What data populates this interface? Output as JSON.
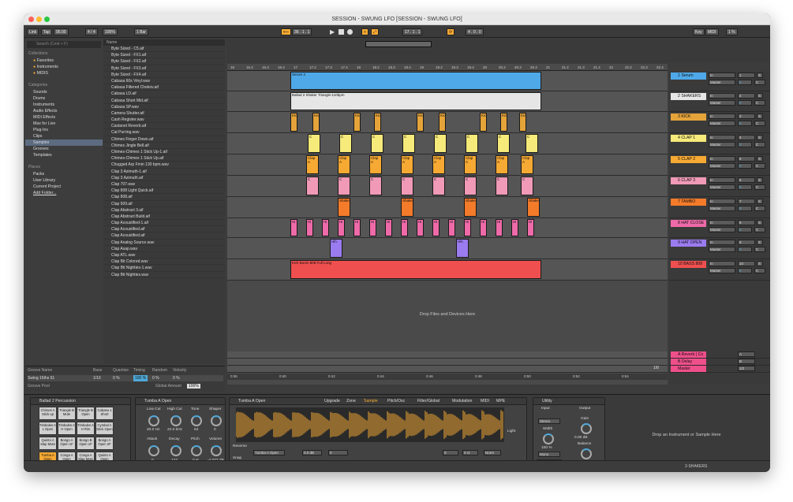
{
  "window": {
    "title": "SESSION - SWUNG LFO  [SESSION - SWUNG LFO]"
  },
  "control": {
    "link": "Link",
    "tap": "Tap",
    "tempo": "95.00",
    "sig": "4 / 4",
    "zoom": "100%",
    "bar": "1 Bar",
    "pos1": "36 .  1 .  1",
    "pos2": "17 .  1 .  1",
    "len": "4 .  0 .  0",
    "key": "Key",
    "midi": "MIDI",
    "cpu": "1 %"
  },
  "browser": {
    "search_placeholder": "Search (Cmd + F)",
    "collections_h": "Collections",
    "collections": [
      "Favorites",
      "Instruments",
      "MIDIS"
    ],
    "categories_h": "Categories",
    "categories": [
      "Sounds",
      "Drums",
      "Instruments",
      "Audio Effects",
      "MIDI Effects",
      "Max for Live",
      "Plug-Ins",
      "Clips",
      "Samples",
      "Grooves",
      "Templates"
    ],
    "places_h": "Places",
    "places": [
      "Packs",
      "User Library",
      "Current Project",
      "Add Folder..."
    ],
    "name_h": "Name",
    "files": [
      "Byte Sized - C5.aif",
      "Byte Sized - FX1.aif",
      "Byte Sized - FX2.aif",
      "Byte Sized - FX3.aif",
      "Byte Sized - FX4.aif",
      "Cabasa 60s Vinyl.wav",
      "Cabasa Filtered Chekov.aif",
      "Cabasa LD.aif",
      "Cabasa Short Mid.aif",
      "Cabasa SP.wav",
      "Camera Shutter.aif",
      "Cash Register.wav",
      "Castanet Reverb.aif",
      "Cat Purring.wav",
      "Chimes Finger Down.aif",
      "Chimes Jingle Bell.aif",
      "Chimes-Chimes 1 Stick Up-1.aif",
      "Chimes-Chimes 1 Stick Up.aif",
      "Chugged Arp Fmin 130 bpm.wav",
      "Clap 3 Azimuth-1.aif",
      "Clap 3 Azimuth.aif",
      "Clap 707.wav",
      "Clap 808 Light Quick.aif",
      "Clap 808.aif",
      "Clap 909.aif",
      "Clap Abstract 3.aif",
      "Clap Abstract Build.aif",
      "Clap Acoustified-1.aif",
      "Clap Acoustified.aif",
      "Clap Acoustified.aif",
      "Clap Analog Source.wav",
      "Clap Asap.wav",
      "Clap ATL.wav",
      "Clap Bit Colored.wav",
      "Clap Bit Nighties-1.wav",
      "Clap Bit Nighties.wav"
    ]
  },
  "groove": {
    "h_name": "Groove Name",
    "h_base": "Base",
    "h_quantize": "Quantize",
    "h_timing": "Timing",
    "h_random": "Random",
    "h_velocity": "Velocity",
    "name": "Swing 16ths 61",
    "base": "1/16",
    "quantize": "0 %",
    "timing": "100 %",
    "random": "0 %",
    "velocity": "0 %",
    "pool": "Groove Pool",
    "global": "Global Amount",
    "global_val": "100%"
  },
  "ruler": {
    "marks": [
      "16",
      "16.2",
      "16.3",
      "16.4",
      "17",
      "17.2",
      "17.3",
      "17.4",
      "18",
      "18.2",
      "18.3",
      "18.4",
      "19",
      "19.2",
      "19.3",
      "19.4",
      "20",
      "20.2",
      "20.3",
      "20.4",
      "21",
      "21.2",
      "21.3",
      "21.4",
      "22",
      "22.2",
      "22.3",
      "22.4"
    ]
  },
  "tracks": [
    {
      "name": "1 Serum",
      "color": "#4fa9e8",
      "num": "1",
      "clip": "Serum 2"
    },
    {
      "name": "2 SHAKERS",
      "color": "#e6e6e6",
      "num": "2",
      "clip": "Ballad 2 Shaker Triangle-110bpm"
    },
    {
      "name": "3 KICK",
      "color": "#e5a43a",
      "num": "3",
      "clip": "Kick"
    },
    {
      "name": "4 CLAP 1",
      "color": "#f6ea7a",
      "num": "4",
      "clip": "C"
    },
    {
      "name": "5 CLAP 2",
      "color": "#f6a933",
      "num": "5",
      "clip": "Clap A"
    },
    {
      "name": "6 CLAP 3",
      "color": "#f09ab8",
      "num": "6",
      "clip": "C"
    },
    {
      "name": "7 TAMBO",
      "color": "#f47b2a",
      "num": "7",
      "clip": "Shaker"
    },
    {
      "name": "8 HAT CLOSE",
      "color": "#ef6aa8",
      "num": "8",
      "clip": "Hi"
    },
    {
      "name": "9 HAT OPEN",
      "color": "#9b7bf0",
      "num": "9",
      "clip": "Hih"
    },
    {
      "name": "10 BASS 808",
      "color": "#ef4f4f",
      "num": "10",
      "clip": "Kick Boom 808 Full Long"
    }
  ],
  "returns": [
    {
      "name": "A Reverb | Co",
      "num": "A"
    },
    {
      "name": "B Delay",
      "num": "B"
    },
    {
      "name": "Master",
      "num": "1/2"
    }
  ],
  "mixer": {
    "in": "In",
    "auto": "Auto",
    "off": "Off",
    "master": "Master",
    "zero": "0",
    "c": "C",
    "s": "S",
    "inf": "-inf",
    "vol1": "3.0",
    "set": "Set",
    "post": "Post"
  },
  "drop": "Drop Files and Devices Here",
  "bottom_ruler": [
    "0:36",
    "0:40",
    "0:42",
    "0:44",
    "0:46",
    "0:48",
    "0:50",
    "0:52",
    "0:54"
  ],
  "page_count": "1/8",
  "devices": {
    "rack": {
      "title": "Ballad 2 Percussion",
      "pads": [
        "Chimes A Stick up",
        "Triangle B Mute",
        "Triangle B Open",
        "Cabasa 1 Short",
        "Timbales A L Open",
        "Timbales A H Open",
        "Timbales A H Rim",
        "Cymbal A Stick Open",
        "Quinto A Slap Mute",
        "Bongo A Open 1F",
        "Bongo B Open 1F",
        "Bongo A Open 2F",
        "Tumba A Open",
        "Conga A Open",
        "Conga A Slap Mute",
        "Quinto A Open"
      ]
    },
    "chain": {
      "title": "Tumba A Open",
      "k1": "Low Cut",
      "k2": "High Cut",
      "k3": "Tone",
      "k4": "Shaper",
      "v1": "20.0 Hz",
      "v2": "22.0 kHz",
      "v3": "64",
      "v4": "0",
      "k5": "Attack",
      "k6": "Decay",
      "k7": "Pitch",
      "k8": "Volume",
      "v5": "0",
      "v6": "127",
      "v7": "0 st",
      "v8": "-4.077 dB",
      "rand": "Rand",
      "map": "Map"
    },
    "sampler": {
      "title": "Tumba A Open",
      "upgrade": "Upgrade",
      "zone": "Zone",
      "sample": "Sample",
      "pitch": "Pitch/Osc",
      "filter": "Filter/Global",
      "mod": "Modulation",
      "midi": "MIDI",
      "mpe": "MPE",
      "reverse": "Reverse",
      "snap": "Snap",
      "sample_name": "Tumba A Open",
      "vol": "0.0 dB",
      "start": "0",
      "end": "46079",
      "crossfade": "0",
      "detune": "0 ct",
      "interpol": "Norm",
      "ram": "RAM",
      "light": "Light"
    },
    "utility": {
      "title": "Utility",
      "input": "Input",
      "output": "Output",
      "stereo": "Stereo",
      "gain": "Gain",
      "gain_v": "0.00 dB",
      "width": "Width",
      "width_v": "100 %",
      "mono": "Mono",
      "bass": "Bass Mono",
      "bass_f": "120 Hz",
      "balance": "Balance",
      "bal_v": "C",
      "mute": "Mute",
      "dc": "DC"
    },
    "drop2": "Drop an Instrument or Sample Here"
  },
  "status": {
    "track": "2-SHAKERS"
  }
}
